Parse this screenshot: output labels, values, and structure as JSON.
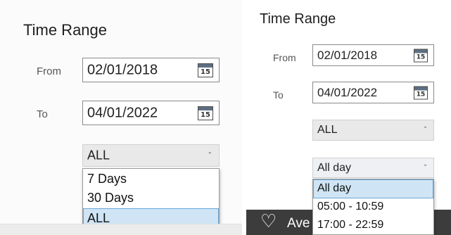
{
  "left_panel": {
    "title": "Time Range",
    "from_label": "From",
    "from_value": "02/01/2018",
    "to_label": "To",
    "to_value": "04/01/2022",
    "calendar_day": "15",
    "range_select": {
      "value": "ALL",
      "chevron": "˅",
      "options": [
        "7 Days",
        "30 Days",
        "ALL"
      ],
      "selected_option": "ALL"
    }
  },
  "right_panel": {
    "title": "Time Range",
    "from_label": "From",
    "from_value": "02/01/2018",
    "to_label": "To",
    "to_value": "04/01/2022",
    "calendar_day": "15",
    "range_select": {
      "value": "ALL",
      "chevron": "˅"
    },
    "time_select": {
      "value": "All day",
      "chevron": "˅",
      "options": [
        "All day",
        "05:00 - 10:59",
        "17:00 - 22:59"
      ],
      "selected_option": "All day"
    },
    "footer": {
      "icon": "heart-outline-icon",
      "text": "Ave"
    }
  },
  "colors": {
    "selected_option_bg": "#cfe5f5",
    "selected_option_border": "#6aa6d6",
    "select_bg": "#e9e9e9",
    "footer_dark": "#3c3c3c"
  }
}
